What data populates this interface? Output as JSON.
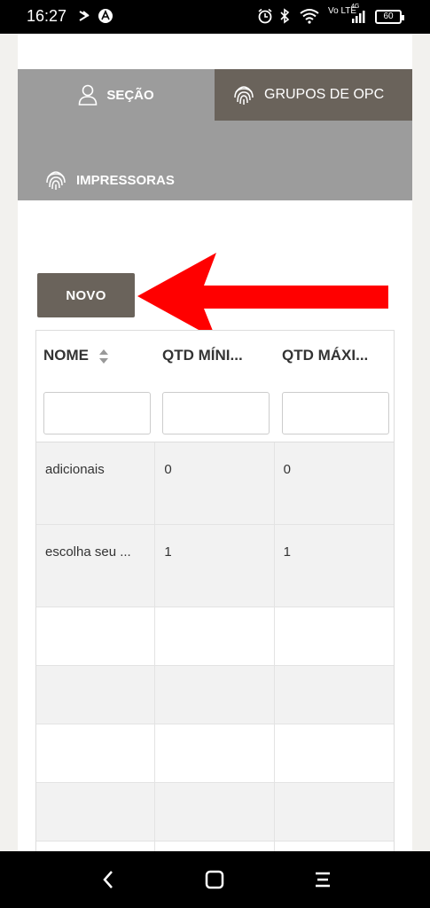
{
  "status_bar": {
    "time": "16:27",
    "network_label": "Vo LTE",
    "signal_label": "4G",
    "battery": "60"
  },
  "tabs": [
    {
      "label": "SEÇÃO",
      "icon": "person-icon",
      "active": true
    },
    {
      "label": "GRUPOS DE OPC",
      "icon": "fingerprint-icon",
      "active": false
    },
    {
      "label": "IMPRESSORAS",
      "icon": "fingerprint-icon",
      "active": false
    }
  ],
  "novo_button": "NOVO",
  "table": {
    "columns": [
      "NOME",
      "QTD MÍNI...",
      "QTD MÁXI..."
    ],
    "rows": [
      {
        "nome": "adicionais",
        "qtd_min": "0",
        "qtd_max": "0"
      },
      {
        "nome": "escolha seu ...",
        "qtd_min": "1",
        "qtd_max": "1"
      }
    ]
  },
  "colors": {
    "tab_bar": "#9c9c9c",
    "tab_active_dark": "#6a635b",
    "button": "#6a635b",
    "arrow": "#ff0000"
  }
}
